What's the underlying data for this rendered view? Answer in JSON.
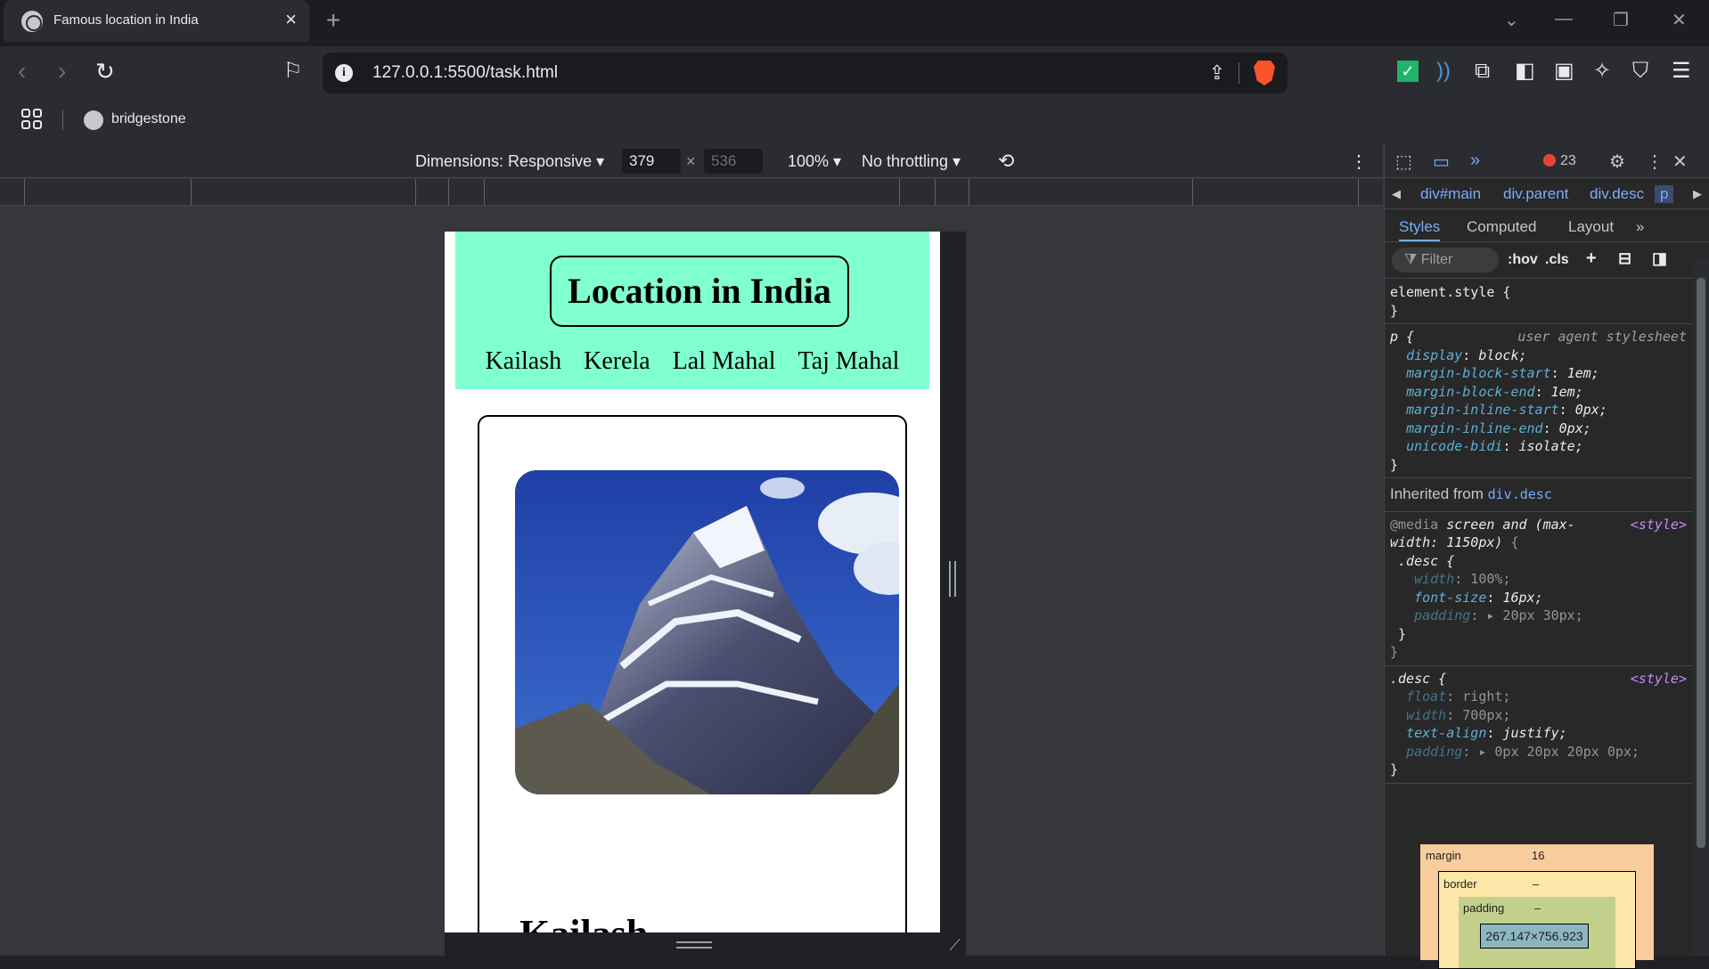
{
  "browser": {
    "tab_title": "Famous location in India",
    "url": "127.0.0.1:5500/task.html",
    "bookmark": "bridgestone"
  },
  "device_toolbar": {
    "dimensions": "Dimensions: Responsive ▾",
    "width": "379",
    "height": "536",
    "zoom": "100% ▾",
    "throttling": "No throttling ▾"
  },
  "page": {
    "title": "Location in India",
    "nav": [
      "Kailash",
      "Kerela",
      "Lal Mahal",
      "Taj Mahal"
    ],
    "card_heading": "Kailash",
    "header_color": "#80ffcf"
  },
  "devtools": {
    "error_count": "23",
    "breadcrumbs": [
      "div#main",
      "div.parent",
      "div.desc",
      "p"
    ],
    "tabs": [
      "Styles",
      "Computed",
      "Layout"
    ],
    "filter_placeholder": "Filter",
    "hov": ":hov",
    "cls": ".cls",
    "element_style": "element.style {",
    "ua_source": "user agent stylesheet",
    "inherited_label": "Inherited from",
    "inherited_from": "div.desc",
    "style_link": "<style>",
    "box_model": {
      "margin_label": "margin",
      "margin_value": "16",
      "border_label": "border",
      "border_value": "–",
      "padding_label": "padding",
      "padding_value": "–",
      "content_size": "267.147×756.923"
    }
  }
}
